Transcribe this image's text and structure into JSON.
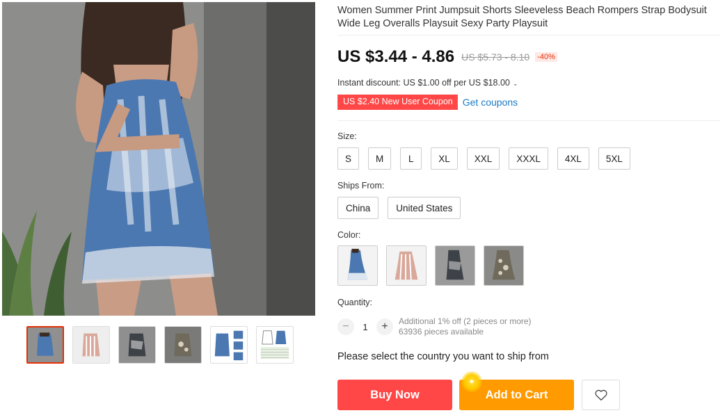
{
  "product": {
    "title": "Women Summer Print Jumpsuit Shorts Sleeveless Beach Rompers Strap Bodysuit Wide Leg Overalls Playsuit Sexy Party Playsuit",
    "price": "US $3.44 - 4.86",
    "old_price": "US $5.73 - 8.10",
    "discount": "-40%",
    "instant_discount": "Instant discount: US $1.00 off per US $18.00",
    "coupon": "US $2.40 New User Coupon",
    "get_coupons": "Get coupons"
  },
  "size": {
    "label": "Size:",
    "options": [
      "S",
      "M",
      "L",
      "XL",
      "XXL",
      "XXXL",
      "4XL",
      "5XL"
    ]
  },
  "ships_from": {
    "label": "Ships From:",
    "options": [
      "China",
      "United States"
    ]
  },
  "color": {
    "label": "Color:",
    "swatches": [
      "blue-tie-dye",
      "pink-stripe",
      "black-print",
      "floral-print"
    ]
  },
  "quantity": {
    "label": "Quantity:",
    "value": "1",
    "minus": "−",
    "plus": "+",
    "note_line1": "Additional 1% off (2 pieces or more)",
    "note_line2": "63936 pieces available"
  },
  "ship_message": "Please select the country you want to ship from",
  "actions": {
    "buy_now": "Buy Now",
    "add_to_cart": "Add to Cart",
    "wishlist_icon": "heart-icon"
  },
  "colors": {
    "price_red": "#ff4747",
    "cart_orange": "#ff9a00",
    "link_blue": "#1b7bc8",
    "discount_red": "#e62e04"
  }
}
